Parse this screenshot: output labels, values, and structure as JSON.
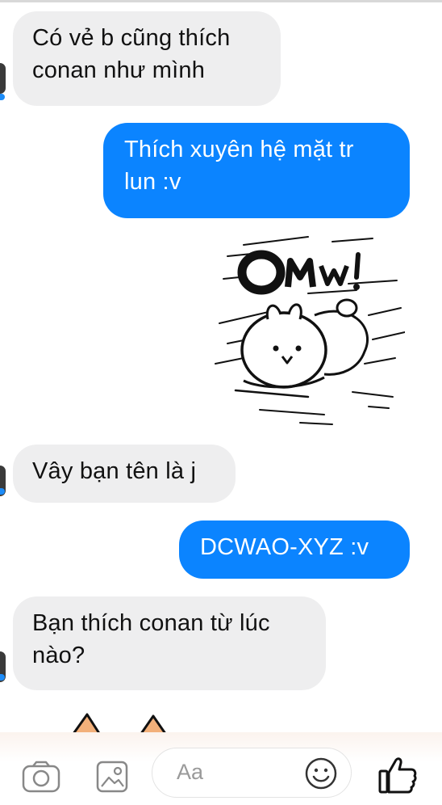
{
  "thread": {
    "messages": [
      {
        "side": "incoming",
        "text": "Có vẻ b cũng thích conan như mình"
      },
      {
        "side": "outgoing",
        "text": "Thích xuyên hệ mặt tr lun :v"
      },
      {
        "side": "outgoing",
        "sticker": "running-bunny-omw-sticker",
        "sticker_text": "OMW!"
      },
      {
        "side": "incoming",
        "text": "Vây bạn tên là j"
      },
      {
        "side": "outgoing",
        "text": "DCWAO-XYZ :v"
      },
      {
        "side": "incoming",
        "text": "Bạn thích conan từ lúc nào?"
      }
    ]
  },
  "composer": {
    "placeholder": "Aa",
    "icons": [
      "camera-icon",
      "gallery-icon",
      "emoji-icon",
      "thumbs-up-icon"
    ]
  },
  "colors": {
    "outgoing_bubble": "#0b84ff",
    "incoming_bubble": "#eeeeef",
    "avatar_indicator": "#1d8cf8"
  }
}
